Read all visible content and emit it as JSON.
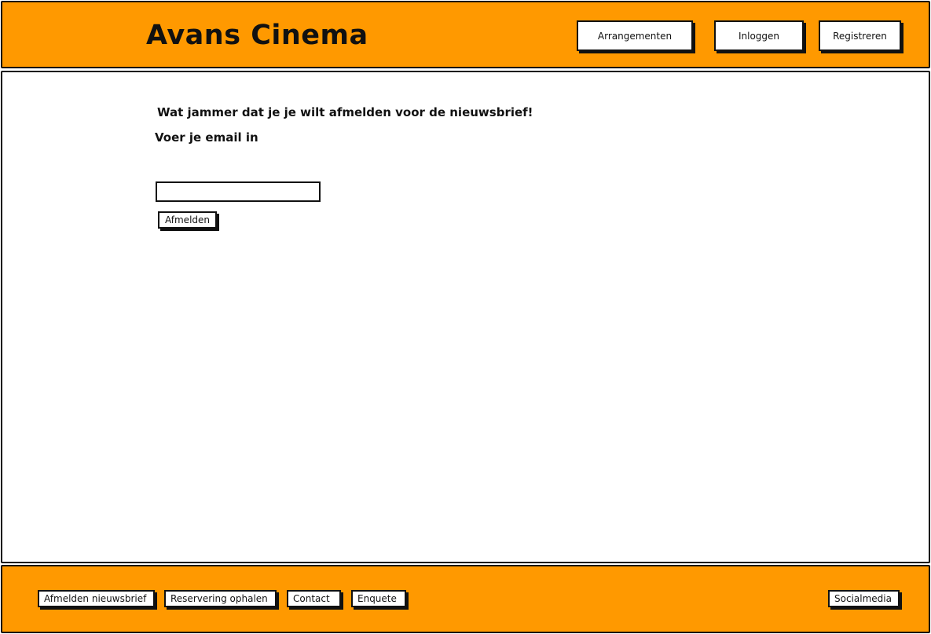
{
  "header": {
    "logo": "Avans Cinema",
    "nav": {
      "arrangementen": "Arrangementen",
      "inloggen": "Inloggen",
      "registreren": "Registreren"
    }
  },
  "main": {
    "heading": "Wat jammer dat je je wilt afmelden voor de nieuwsbrief!",
    "email_prompt": "Voer je email in",
    "email_value": "",
    "submit_label": "Afmelden"
  },
  "footer": {
    "links": {
      "afmelden_nieuwsbrief": "Afmelden nieuwsbrief",
      "reservering_ophalen": "Reservering ophalen",
      "contact": "Contact",
      "enquete": "Enquete",
      "socialmedia": "Socialmedia"
    }
  },
  "colors": {
    "accent": "#ff9900",
    "border": "#111111",
    "background": "#ffffff"
  }
}
